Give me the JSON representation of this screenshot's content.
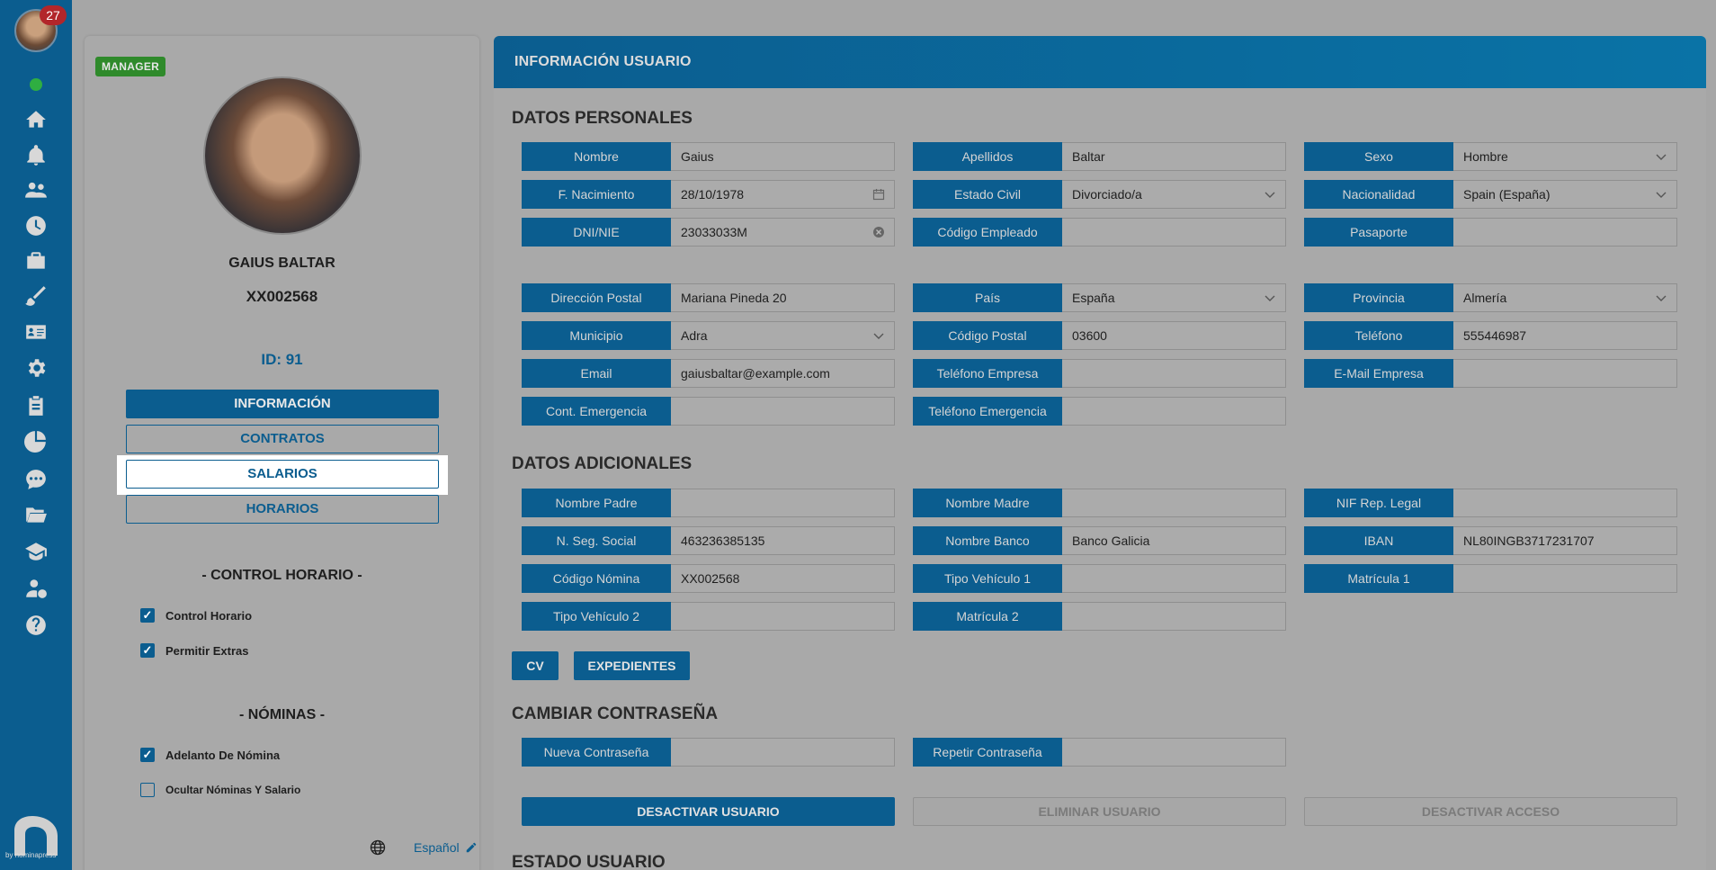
{
  "rail": {
    "notification_count": "27",
    "icons": [
      "home-icon",
      "bell-icon",
      "users-icon",
      "clock-icon",
      "briefcase-icon",
      "brush-icon",
      "id-card-icon",
      "gear-icon",
      "clipboard-icon",
      "pie-chart-icon",
      "chat-icon",
      "folder-icon",
      "graduation-cap-icon",
      "user-salary-icon",
      "help-icon"
    ],
    "logo_caption": "by nominapress"
  },
  "profile": {
    "role": "MANAGER",
    "name": "GAIUS BALTAR",
    "code": "XX002568",
    "id_label": "ID: 91",
    "nav": [
      "INFORMACIÓN",
      "CONTRATOS",
      "SALARIOS",
      "HORARIOS"
    ],
    "control_title": "- CONTROL HORARIO -",
    "control_options": [
      {
        "label": "Control Horario",
        "checked": true
      },
      {
        "label": "Permitir Extras",
        "checked": true
      }
    ],
    "payroll_title": "- NÓMINAS -",
    "payroll_options": [
      {
        "label": "Adelanto De Nómina",
        "checked": true
      },
      {
        "label": "Ocultar Nóminas Y Salario",
        "checked": false
      }
    ],
    "language": "Español"
  },
  "main": {
    "header": "INFORMACIÓN USUARIO",
    "personal_title": "DATOS PERSONALES",
    "personal": [
      [
        {
          "label": "Nombre",
          "value": "Gaius"
        },
        {
          "label": "Apellidos",
          "value": "Baltar"
        },
        {
          "label": "Sexo",
          "value": "Hombre",
          "dropdown": true
        }
      ],
      [
        {
          "label": "F. Nacimiento",
          "value": "28/10/1978",
          "calendar": true
        },
        {
          "label": "Estado Civil",
          "value": "Divorciado/a",
          "dropdown": true
        },
        {
          "label": "Nacionalidad",
          "value": "Spain (España)",
          "dropdown": true
        }
      ],
      [
        {
          "label": "DNI/NIE",
          "value": "23033033M",
          "clear": true
        },
        {
          "label": "Código Empleado",
          "value": ""
        },
        {
          "label": "Pasaporte",
          "value": ""
        }
      ]
    ],
    "address": [
      [
        {
          "label": "Dirección Postal",
          "value": "Mariana Pineda 20"
        },
        {
          "label": "País",
          "value": "España",
          "dropdown": true
        },
        {
          "label": "Provincia",
          "value": "Almería",
          "dropdown": true
        }
      ],
      [
        {
          "label": "Municipio",
          "value": "Adra",
          "dropdown": true
        },
        {
          "label": "Código Postal",
          "value": "03600"
        },
        {
          "label": "Teléfono",
          "value": "555446987"
        }
      ],
      [
        {
          "label": "Email",
          "value": "gaiusbaltar@example.com"
        },
        {
          "label": "Teléfono Empresa",
          "value": ""
        },
        {
          "label": "E-Mail Empresa",
          "value": ""
        }
      ],
      [
        {
          "label": "Cont. Emergencia",
          "value": ""
        },
        {
          "label": "Teléfono Emergencia",
          "value": ""
        }
      ]
    ],
    "additional_title": "DATOS ADICIONALES",
    "additional": [
      [
        {
          "label": "Nombre Padre",
          "value": ""
        },
        {
          "label": "Nombre Madre",
          "value": ""
        },
        {
          "label": "NIF Rep. Legal",
          "value": ""
        }
      ],
      [
        {
          "label": "N. Seg. Social",
          "value": "463236385135"
        },
        {
          "label": "Nombre Banco",
          "value": "Banco Galicia"
        },
        {
          "label": "IBAN",
          "value": "NL80INGB3717231707"
        }
      ],
      [
        {
          "label": "Código Nómina",
          "value": "XX002568"
        },
        {
          "label": "Tipo Vehículo 1",
          "value": ""
        },
        {
          "label": "Matrícula 1",
          "value": ""
        }
      ],
      [
        {
          "label": "Tipo Vehículo 2",
          "value": ""
        },
        {
          "label": "Matrícula 2",
          "value": ""
        }
      ]
    ],
    "doc_buttons": [
      "CV",
      "EXPEDIENTES"
    ],
    "password_title": "CAMBIAR CONTRASEÑA",
    "password": [
      [
        {
          "label": "Nueva Contraseña",
          "value": ""
        },
        {
          "label": "Repetir Contraseña",
          "value": ""
        }
      ]
    ],
    "actions": [
      "DESACTIVAR USUARIO",
      "ELIMINAR USUARIO",
      "DESACTIVAR ACCESO"
    ],
    "status_title": "ESTADO USUARIO"
  }
}
